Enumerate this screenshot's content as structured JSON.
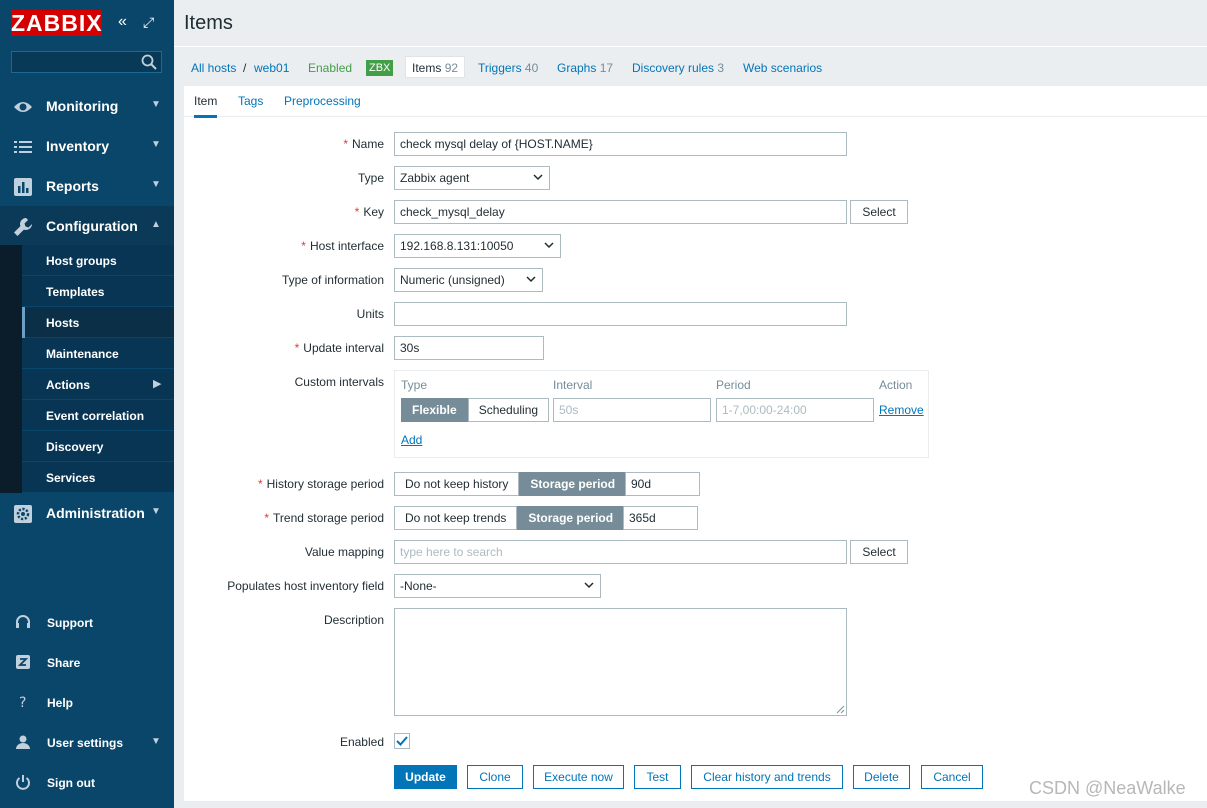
{
  "sidebar": {
    "logo": "ZABBIX",
    "collapse_icon": "«",
    "kiosk_icon": "⤢",
    "search_placeholder": "",
    "menu": [
      {
        "label": "Monitoring",
        "icon": "eye-icon"
      },
      {
        "label": "Inventory",
        "icon": "list-icon"
      },
      {
        "label": "Reports",
        "icon": "bar-chart-icon"
      },
      {
        "label": "Configuration",
        "icon": "wrench-icon"
      },
      {
        "label": "Administration",
        "icon": "gear-icon"
      }
    ],
    "config_items": [
      "Host groups",
      "Templates",
      "Hosts",
      "Maintenance",
      "Actions",
      "Event correlation",
      "Discovery",
      "Services"
    ],
    "bottom": [
      {
        "label": "Support",
        "icon": "headset-icon"
      },
      {
        "label": "Share",
        "icon": "share-icon"
      },
      {
        "label": "Help",
        "icon": "help-icon"
      },
      {
        "label": "User settings",
        "icon": "user-icon"
      },
      {
        "label": "Sign out",
        "icon": "power-icon"
      }
    ]
  },
  "header": {
    "title": "Items"
  },
  "breadcrumb": {
    "all_hosts": "All hosts",
    "sep": "/",
    "host": "web01",
    "status": "Enabled",
    "zbx": "ZBX",
    "items": "Items",
    "items_count": "92",
    "triggers": "Triggers",
    "triggers_count": "40",
    "graphs": "Graphs",
    "graphs_count": "17",
    "discovery": "Discovery rules",
    "discovery_count": "3",
    "web": "Web scenarios"
  },
  "tabs": [
    "Item",
    "Tags",
    "Preprocessing"
  ],
  "form": {
    "name_label": "Name",
    "name_value": "check mysql delay of {HOST.NAME}",
    "type_label": "Type",
    "type_value": "Zabbix agent",
    "key_label": "Key",
    "key_value": "check_mysql_delay",
    "select_label": "Select",
    "iface_label": "Host interface",
    "iface_value": "192.168.8.131:10050",
    "toi_label": "Type of information",
    "toi_value": "Numeric (unsigned)",
    "units_label": "Units",
    "units_value": "",
    "update_label": "Update interval",
    "update_value": "30s",
    "custom_label": "Custom intervals",
    "ci_type": "Type",
    "ci_interval": "Interval",
    "ci_period": "Period",
    "ci_action": "Action",
    "ci_flexible": "Flexible",
    "ci_scheduling": "Scheduling",
    "ci_interval_ph": "50s",
    "ci_period_ph": "1-7,00:00-24:00",
    "ci_remove": "Remove",
    "ci_add": "Add",
    "history_label": "History storage period",
    "history_off": "Do not keep history",
    "history_on": "Storage period",
    "history_value": "90d",
    "trend_label": "Trend storage period",
    "trend_off": "Do not keep trends",
    "trend_on": "Storage period",
    "trend_value": "365d",
    "vm_label": "Value mapping",
    "vm_ph": "type here to search",
    "inv_label": "Populates host inventory field",
    "inv_value": "-None-",
    "desc_label": "Description",
    "enabled_label": "Enabled"
  },
  "actions": [
    "Update",
    "Clone",
    "Execute now",
    "Test",
    "Clear history and trends",
    "Delete",
    "Cancel"
  ],
  "watermark": "CSDN @NeaWalke"
}
